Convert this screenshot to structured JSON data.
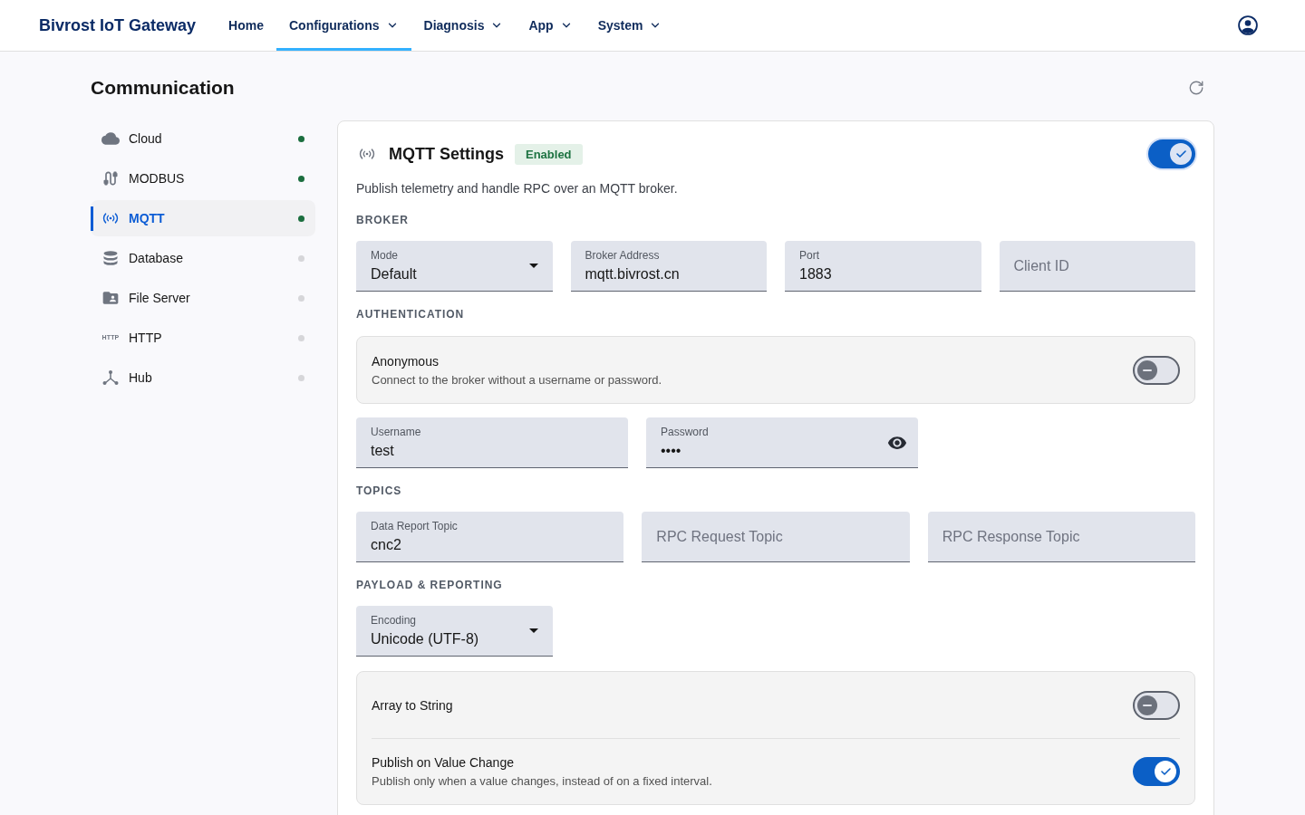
{
  "header": {
    "title": "Bivrost IoT Gateway",
    "nav": [
      {
        "label": "Home",
        "has_menu": false,
        "selected": false
      },
      {
        "label": "Configurations",
        "has_menu": true,
        "selected": true
      },
      {
        "label": "Diagnosis",
        "has_menu": true,
        "selected": false
      },
      {
        "label": "App",
        "has_menu": true,
        "selected": false
      },
      {
        "label": "System",
        "has_menu": true,
        "selected": false
      }
    ]
  },
  "page": {
    "title": "Communication"
  },
  "sidebar": {
    "items": [
      {
        "label": "Cloud",
        "kind": "cloud",
        "selected": false,
        "color": "#1b6e3e"
      },
      {
        "label": "MODBUS",
        "kind": "cable",
        "selected": false,
        "color": "#1b6e3e"
      },
      {
        "label": "MQTT",
        "kind": "wireless",
        "selected": true,
        "color": "#1b6e3e"
      },
      {
        "label": "Database",
        "kind": "database",
        "selected": false,
        "color": "#d6d6d9"
      },
      {
        "label": "File Server",
        "kind": "folder",
        "selected": false,
        "color": "#d6d6d9"
      },
      {
        "label": "HTTP",
        "kind": "text",
        "icon_text": "HTTP",
        "selected": false,
        "color": "#d6d6d9"
      },
      {
        "label": "Hub",
        "kind": "hub",
        "selected": false,
        "color": "#d6d6d9"
      }
    ]
  },
  "settings": {
    "title": "MQTT Settings",
    "status": "Enabled",
    "enabled": true,
    "focused": true,
    "description": "Publish telemetry and handle RPC over an MQTT broker.",
    "sections": [
      {
        "heading": "BROKER",
        "blocks": [
          {
            "kind": "fields",
            "fields": [
              {
                "kind": "select",
                "label": "Mode",
                "value": "Default"
              },
              {
                "kind": "text",
                "label": "Broker Address",
                "value": "mqtt.bivrost.cn"
              },
              {
                "kind": "text",
                "label": "Port",
                "value": "1883"
              },
              {
                "kind": "text",
                "placeholder": "Client ID"
              }
            ]
          }
        ]
      },
      {
        "heading": "AUTHENTICATION",
        "blocks": [
          {
            "kind": "options",
            "options": [
              {
                "title": "Anonymous",
                "description": "Connect to the broker without a username or password.",
                "on": false
              }
            ]
          },
          {
            "kind": "fields",
            "fields": [
              {
                "kind": "text",
                "label": "Username",
                "value": "test"
              },
              {
                "kind": "password",
                "label": "Password",
                "value": "••••"
              }
            ]
          }
        ]
      },
      {
        "heading": "TOPICS",
        "blocks": [
          {
            "kind": "fields",
            "fields": [
              {
                "kind": "text",
                "label": "Data Report Topic",
                "value": "cnc2"
              },
              {
                "kind": "text",
                "placeholder": "RPC Request Topic"
              },
              {
                "kind": "text",
                "placeholder": "RPC Response Topic"
              }
            ]
          }
        ]
      },
      {
        "heading": "PAYLOAD & REPORTING",
        "blocks": [
          {
            "kind": "fields",
            "fields": [
              {
                "kind": "select",
                "label": "Encoding",
                "value": "Unicode (UTF-8)"
              }
            ]
          },
          {
            "kind": "options",
            "options": [
              {
                "title": "Array to String",
                "on": false
              },
              {
                "title": "Publish on Value Change",
                "description": "Publish only when a value changes, instead of on a fixed interval.",
                "on": true
              }
            ]
          }
        ]
      }
    ]
  }
}
